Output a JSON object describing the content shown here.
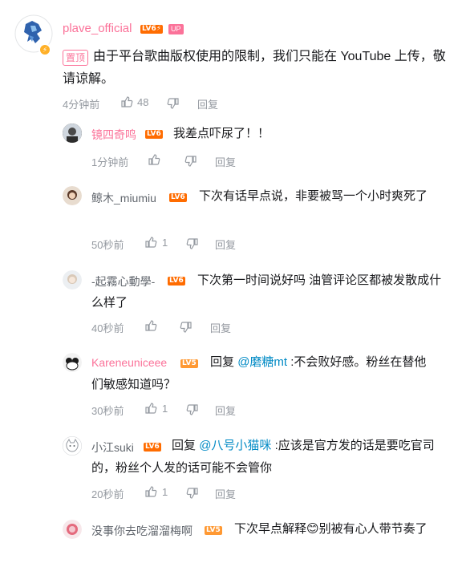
{
  "main_comment": {
    "username": "plave_official",
    "level": "LV6⚡",
    "up_badge": "UP",
    "verify_badge": "⚡",
    "pin_label": "置顶",
    "text": "由于平台歌曲版权使用的限制，我们只能在 YouTube 上传，敬请谅解。",
    "time": "4分钟前",
    "like_count": "48",
    "reply_label": "回复"
  },
  "replies": [
    {
      "username": "镜四奇鸣",
      "username_color": "#fb7299",
      "level": "LV6",
      "text": "我差点吓尿了！！",
      "time": "1分钟前",
      "like_count": "",
      "reply_label": "回复"
    },
    {
      "username": "鲸木_miumiu",
      "username_color": "#61666d",
      "level": "LV6",
      "text": "下次有话早点说，非要被骂一个小时爽死了",
      "time": "50秒前",
      "like_count": "1",
      "reply_label": "回复"
    },
    {
      "username": "-起霧心動學-",
      "username_color": "#61666d",
      "level": "LV6",
      "text": "下次第一时间说好吗 油管评论区都被发散成什么样了",
      "time": "40秒前",
      "like_count": "",
      "reply_label": "回复"
    },
    {
      "username": "Kareneuniceee",
      "username_color": "#fb7299",
      "level": "LV5",
      "reply_prefix": "回复",
      "mention": "@磨糖mt",
      "text": ":不会败好感。粉丝在替他们敏感知道吗？",
      "time": "30秒前",
      "like_count": "1",
      "reply_label": "回复"
    },
    {
      "username": "小江suki",
      "username_color": "#61666d",
      "level": "LV6",
      "reply_prefix": "回复",
      "mention": "@八号小猫咪",
      "text": ":应该是官方发的话是要吃官司的，粉丝个人发的话可能不会管你",
      "time": "20秒前",
      "like_count": "1",
      "reply_label": "回复"
    },
    {
      "username": "没事你去吃溜溜梅啊",
      "username_color": "#61666d",
      "level": "LV5",
      "text_before_emoji": "下次早点解释",
      "emoji": "😊",
      "text_after_emoji": "别被有心人带节奏了"
    }
  ],
  "colors": {
    "accent": "#fb7299",
    "level6": "#ff6c00",
    "level5": "#ff9933",
    "mention": "#008ac5",
    "meta": "#9499a0"
  },
  "icons": {
    "like": "thumb-up-icon",
    "dislike": "thumb-down-icon"
  }
}
